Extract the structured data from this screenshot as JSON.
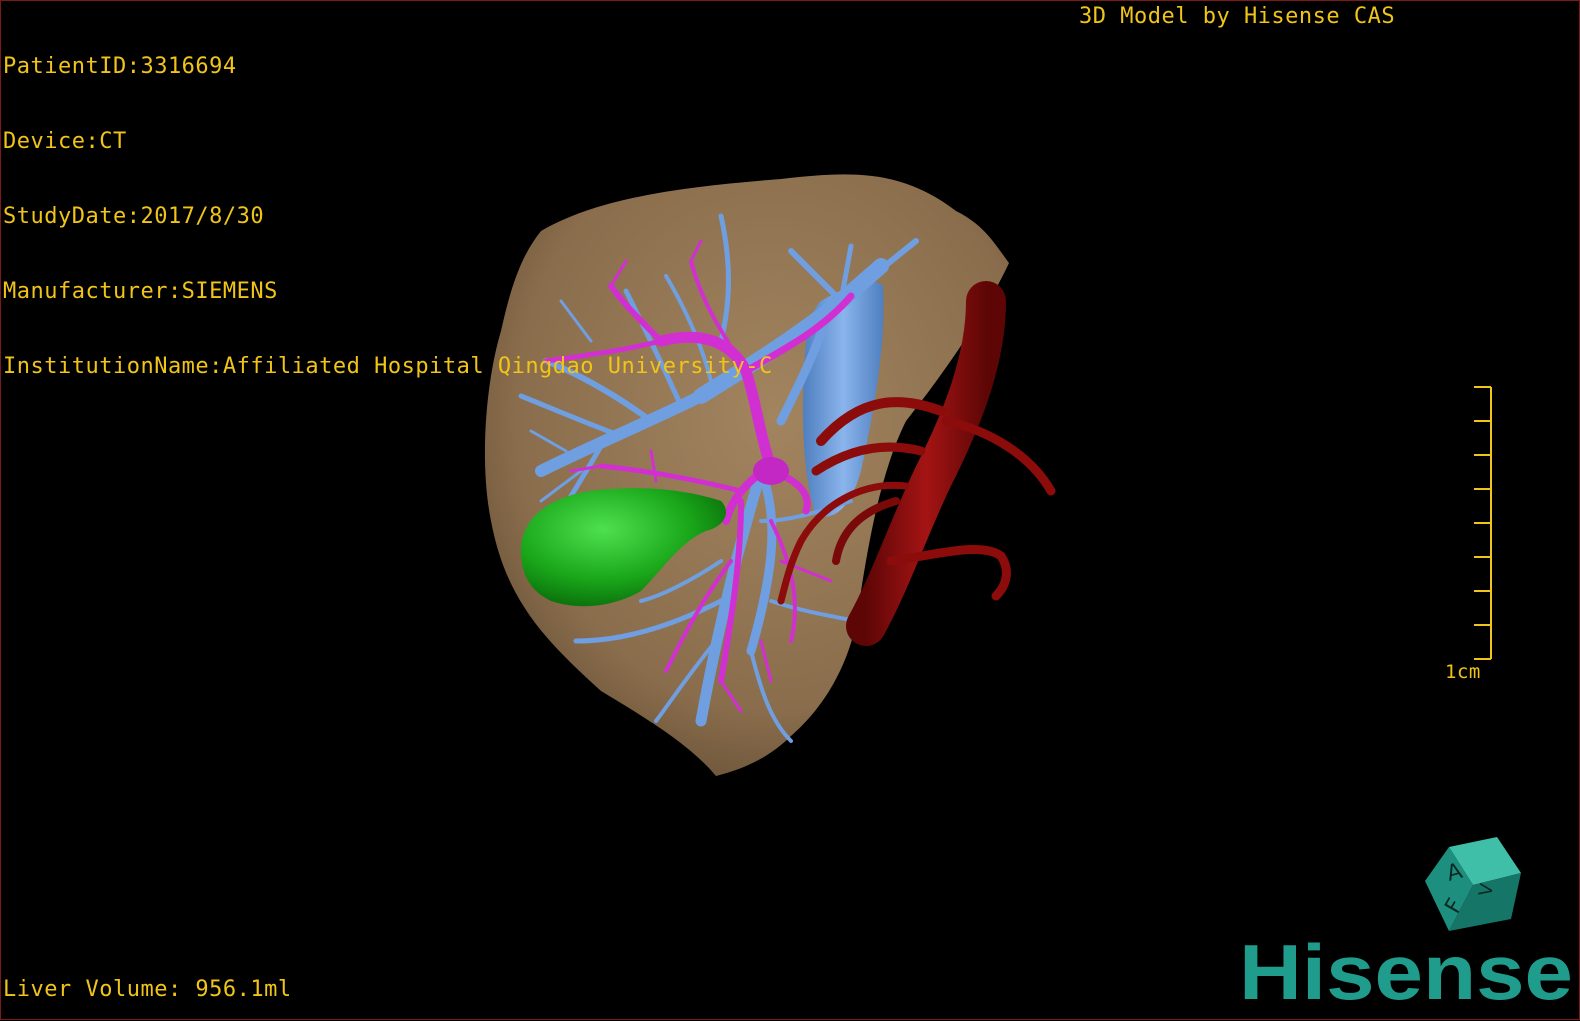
{
  "overlay": {
    "info_lines": [
      "PatientID:3316694",
      "Device:CT",
      "StudyDate:2017/8/30",
      "Manufacturer:SIEMENS",
      "InstitutionName:Affiliated Hospital Qingdao University-C"
    ],
    "model_credit": "3D Model by Hisense CAS",
    "liver_volume": "Liver Volume: 956.1ml",
    "scale_label": "1cm"
  },
  "orientation_cube": {
    "labels": [
      "A",
      "F",
      "V"
    ]
  },
  "brand": {
    "logo_text": "Hisense"
  },
  "colors": {
    "overlay_text": "#f0c418",
    "liver": "#8f7350",
    "portal_vein": "#6f9fe0",
    "bile_duct": "#d22fd2",
    "gallbladder": "#1fb01f",
    "aorta": "#8c0b0b",
    "brand": "#1f9c8c"
  }
}
